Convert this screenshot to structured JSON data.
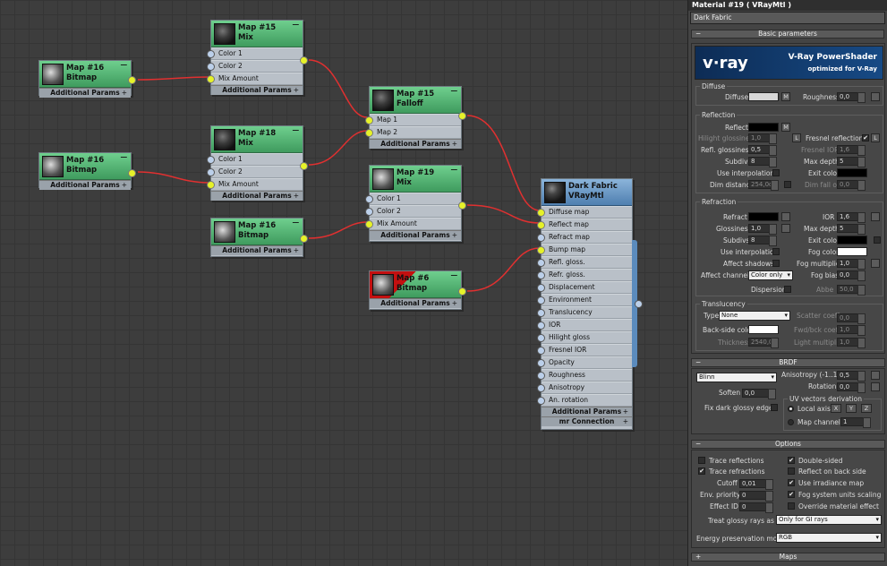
{
  "window": {
    "title": "Material #19  ( VRayMtl )",
    "material_name": "Dark Fabric"
  },
  "nodes": {
    "n16a": {
      "title1": "Map #16",
      "title2": "Bitmap",
      "add": "Additional Params"
    },
    "n16b": {
      "title1": "Map #16",
      "title2": "Bitmap",
      "add": "Additional Params"
    },
    "n15mix": {
      "title1": "Map #15",
      "title2": "Mix",
      "rows": [
        "Color 1",
        "Color 2",
        "Mix Amount"
      ],
      "add": "Additional Params"
    },
    "n18mix": {
      "title1": "Map #18",
      "title2": "Mix",
      "rows": [
        "Color 1",
        "Color 2",
        "Mix Amount"
      ],
      "add": "Additional Params"
    },
    "n16c": {
      "title1": "Map #16",
      "title2": "Bitmap",
      "add": "Additional Params"
    },
    "n15fall": {
      "title1": "Map #15",
      "title2": "Falloff",
      "rows": [
        "Map 1",
        "Map 2"
      ],
      "add": "Additional Params"
    },
    "n19mix": {
      "title1": "Map #19",
      "title2": "Mix",
      "rows": [
        "Color 1",
        "Color 2",
        "Mix Amount"
      ],
      "add": "Additional Params"
    },
    "n6": {
      "title1": "Map #6",
      "title2": "Bitmap",
      "add": "Additional Params"
    },
    "vray": {
      "title1": "Dark Fabric",
      "title2": "VRayMtl",
      "rows": [
        "Diffuse map",
        "Reflect map",
        "Refract map",
        "Bump map",
        "Refl. gloss.",
        "Refr. gloss.",
        "Displacement",
        "Environment",
        "Translucency",
        "IOR",
        "Hilight gloss",
        "Fresnel IOR",
        "Opacity",
        "Roughness",
        "Anisotropy",
        "An. rotation"
      ],
      "add": "Additional Params",
      "add2": "mr Connection"
    }
  },
  "panel": {
    "rollouts": {
      "basic": "Basic parameters",
      "brdf": "BRDF",
      "options": "Options",
      "maps": "Maps"
    },
    "banner": {
      "logo": "v·ray",
      "line1": "V-Ray PowerShader",
      "line2": "optimized for V-Ray"
    },
    "diffuse": {
      "group": "Diffuse",
      "diffuse": "Diffuse",
      "roughness": "Roughness",
      "roughness_val": "0,0",
      "m": "M"
    },
    "reflection": {
      "group": "Reflection",
      "reflect": "Reflect",
      "hilight": "Hilight glossiness",
      "hilight_val": "1,0",
      "l": "L",
      "fresnel": "Fresnel reflections",
      "refl_gloss": "Refl. glossiness",
      "refl_gloss_val": "0,5",
      "fresnel_ior": "Fresnel IOR",
      "fresnel_ior_val": "1,6",
      "subdivs": "Subdivs",
      "subdivs_val": "8",
      "max_depth": "Max depth",
      "max_depth_val": "5",
      "use_interp": "Use interpolation",
      "exit_color": "Exit color",
      "dim_dist": "Dim distance",
      "dim_dist_val": "254,0c",
      "dim_falloff": "Dim fall off",
      "dim_falloff_val": "0,0"
    },
    "refraction": {
      "group": "Refraction",
      "refract": "Refract",
      "ior": "IOR",
      "ior_val": "1,6",
      "gloss": "Glossiness",
      "gloss_val": "1,0",
      "max_depth": "Max depth",
      "max_depth_val": "5",
      "subdivs": "Subdivs",
      "subdivs_val": "8",
      "exit_color": "Exit color",
      "use_interp": "Use interpolation",
      "fog_color": "Fog color",
      "affect_shadows": "Affect shadows",
      "fog_mult": "Fog multiplier",
      "fog_mult_val": "1,0",
      "affect_ch": "Affect channels",
      "affect_ch_val": "Color only",
      "fog_bias": "Fog bias",
      "fog_bias_val": "0,0",
      "dispersion": "Dispersion",
      "abbe": "Abbe",
      "abbe_val": "50,0"
    },
    "translucency": {
      "group": "Translucency",
      "type": "Type",
      "type_val": "None",
      "scatter": "Scatter coeff",
      "scatter_val": "0,0",
      "backside": "Back-side color",
      "fwd": "Fwd/bck coeff",
      "fwd_val": "1,0",
      "thickness": "Thickness",
      "thickness_val": "2540,0",
      "light_mult": "Light multiplier",
      "light_mult_val": "1,0"
    },
    "brdf": {
      "type_val": "Blinn",
      "aniso": "Anisotropy (-1..1)",
      "aniso_val": "0,5",
      "rotation": "Rotation",
      "rotation_val": "0,0",
      "soften": "Soften",
      "soften_val": "0,0",
      "uv_group": "UV vectors derivation",
      "fix_dark": "Fix dark glossy edges",
      "local_axis": "Local axis",
      "x": "X",
      "y": "Y",
      "z": "Z",
      "map_channel": "Map channel",
      "map_channel_val": "1"
    },
    "options": {
      "trace_refl": "Trace reflections",
      "double_sided": "Double-sided",
      "trace_refr": "Trace refractions",
      "reflect_back": "Reflect on back side",
      "cutoff": "Cutoff",
      "cutoff_val": "0,01",
      "use_irr": "Use irradiance map",
      "env_priority": "Env. priority",
      "env_priority_val": "0",
      "fog_units": "Fog system units scaling",
      "effect_id": "Effect ID",
      "effect_id_val": "0",
      "override": "Override material effect",
      "glossy_gi": "Treat glossy rays as GI",
      "glossy_gi_val": "Only for GI rays",
      "energy": "Energy preservation mode",
      "energy_val": "RGB",
      "check": "✔"
    },
    "colors": {
      "diffuse": "#d8d8d8",
      "reflect": "#000000",
      "refract": "#000000",
      "exit": "#000000",
      "fog": "#ffffff",
      "backside": "#ffffff"
    }
  }
}
